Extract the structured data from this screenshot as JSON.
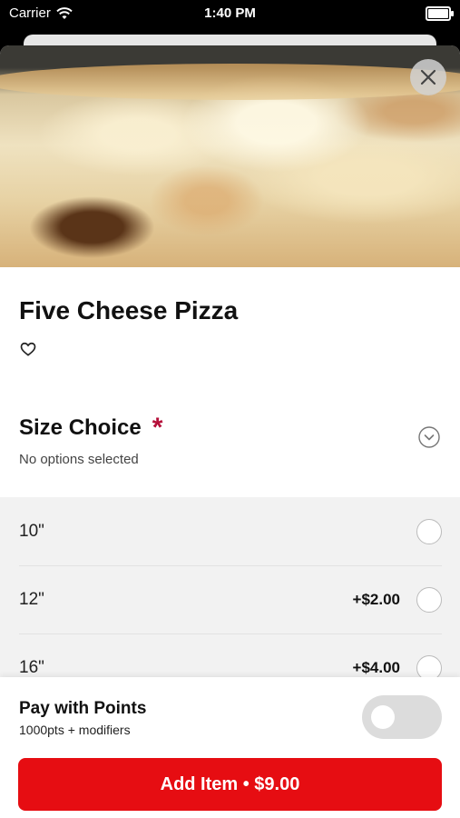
{
  "status_bar": {
    "carrier": "Carrier",
    "time": "1:40 PM"
  },
  "item": {
    "title": "Five Cheese Pizza"
  },
  "size_section": {
    "title": "Size Choice",
    "required_marker": "*",
    "subtitle": "No options selected",
    "options": [
      {
        "label": "10\"",
        "price": ""
      },
      {
        "label": "12\"",
        "price": "+$2.00"
      },
      {
        "label": "16\"",
        "price": "+$4.00"
      }
    ]
  },
  "footer": {
    "pay_title": "Pay with Points",
    "pay_subtitle": "1000pts + modifiers",
    "toggle_on": false,
    "add_button": "Add Item • $9.00"
  },
  "colors": {
    "accent": "#e60d12",
    "required": "#b5103a"
  },
  "icons": {
    "close": "close-icon",
    "favorite": "heart-icon",
    "expand": "chevron-down-icon",
    "wifi": "wifi-icon",
    "battery": "battery-icon"
  }
}
